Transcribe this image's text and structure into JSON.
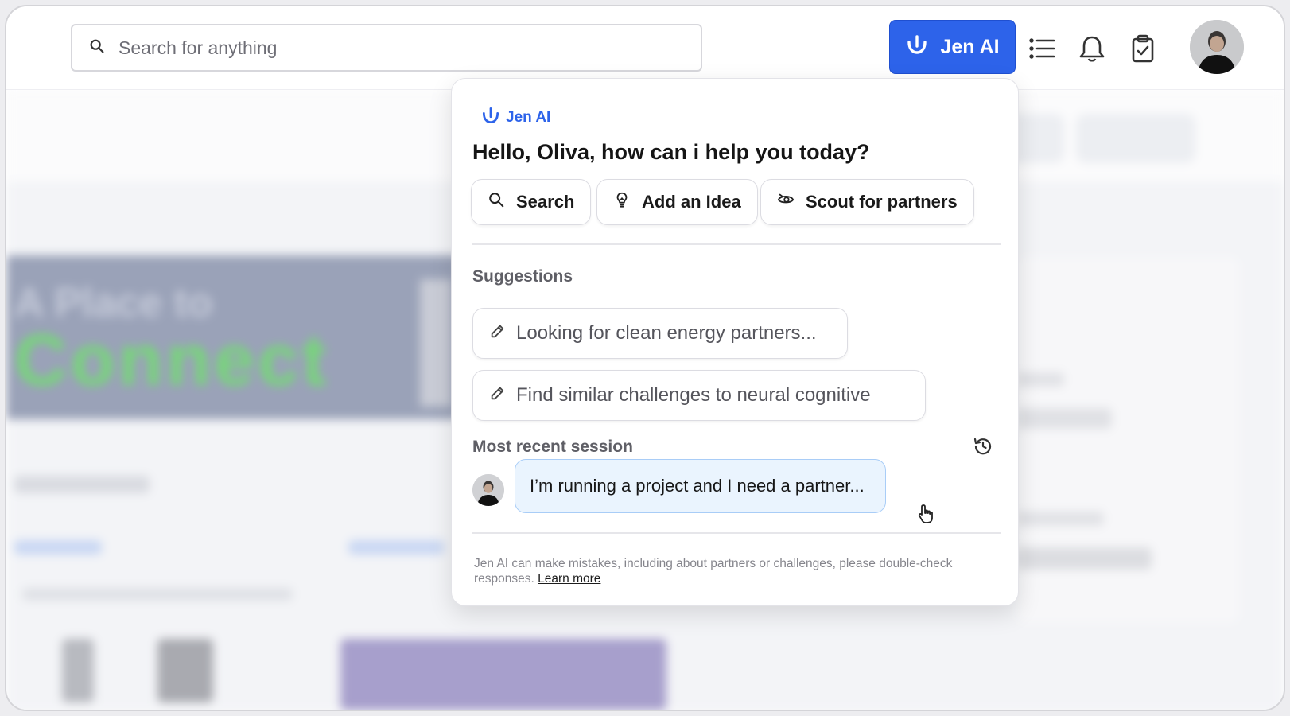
{
  "search": {
    "placeholder": "Search for anything"
  },
  "header": {
    "jen_button_label": "Jen AI",
    "icons": [
      "list-icon",
      "bell-icon",
      "clipboard-check-icon"
    ]
  },
  "background": {
    "hero_line1": "A Place to",
    "hero_line2": "Connect"
  },
  "jen_panel": {
    "brand": "Jen AI",
    "greeting": "Hello, Oliva, how can i help you today?",
    "quick_actions": [
      {
        "label": "Search",
        "icon": "search-icon"
      },
      {
        "label": "Add an Idea",
        "icon": "lightbulb-icon"
      },
      {
        "label": "Scout for partners",
        "icon": "eye-icon"
      }
    ],
    "suggestions_title": "Suggestions",
    "suggestions": [
      "Looking for clean energy partners...",
      "Find similar challenges to neural cognitive"
    ],
    "recent_title": "Most recent session",
    "recent_message": "I’m running a project and I need a partner...",
    "disclaimer": "Jen AI can make mistakes, including about partners or challenges, please double-check responses.",
    "learn_more": "Learn more"
  },
  "colors": {
    "accent": "#2d63ea",
    "bubble_bg": "#eaf4fe",
    "bubble_border": "#a9cdf7"
  }
}
